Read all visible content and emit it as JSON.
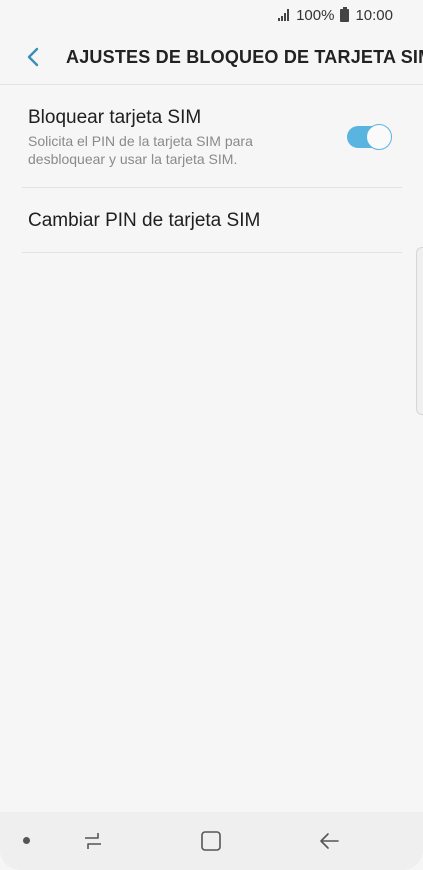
{
  "status_bar": {
    "battery_percent": "100%",
    "time": "10:00"
  },
  "header": {
    "title": "AJUSTES DE BLOQUEO DE TARJETA SIM",
    "back_icon": "chevron-left-icon"
  },
  "settings": {
    "lock_sim": {
      "title": "Bloquear tarjeta SIM",
      "description": "Solicita el PIN de la tarjeta SIM para desbloquear y usar la tarjeta SIM.",
      "enabled": true
    },
    "change_pin": {
      "title": "Cambiar PIN de tarjeta SIM"
    }
  },
  "colors": {
    "accent": "#5ab4e0",
    "background": "#f6f6f6",
    "back_arrow": "#3a8fb7"
  },
  "nav_bar": {
    "icons": [
      "recent-apps-icon",
      "home-icon",
      "back-icon"
    ]
  }
}
